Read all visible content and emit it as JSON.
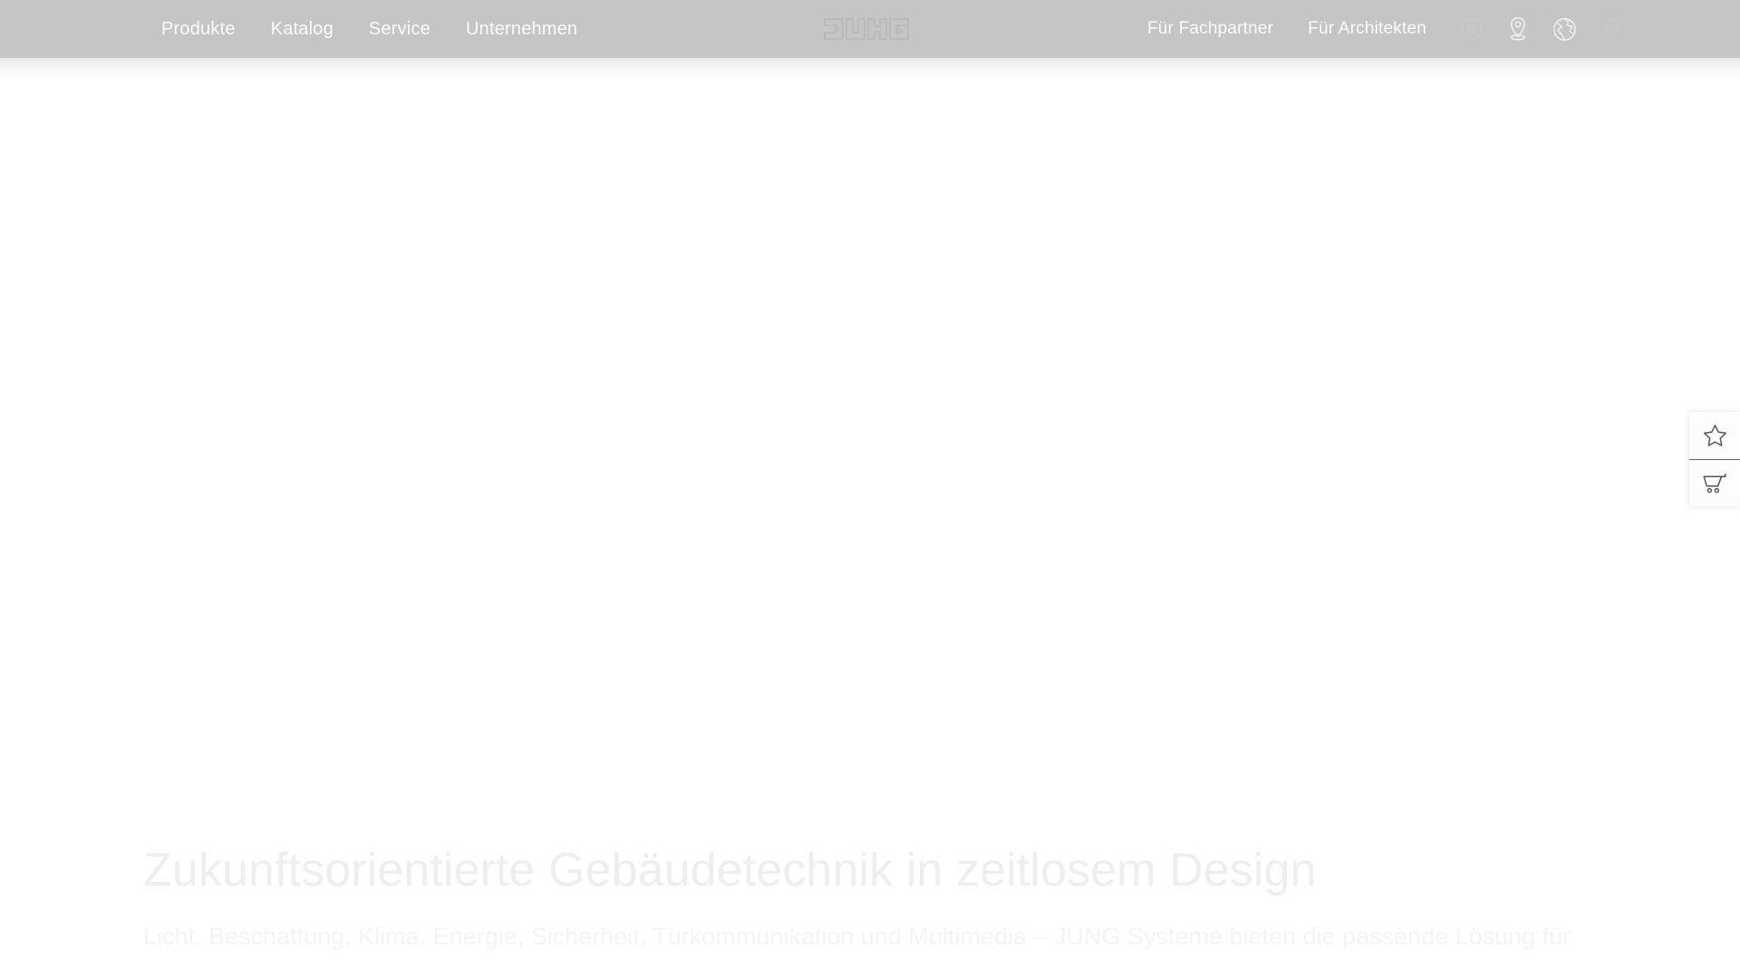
{
  "header": {
    "background_color": "#c5c5c5",
    "text_color": "#fbfbfb",
    "logo": {
      "name": "JUNG",
      "alt": "JUNG"
    },
    "nav_left": [
      {
        "label": "Produkte",
        "icon": ""
      },
      {
        "label": "Katalog",
        "icon": ""
      },
      {
        "label": "Service",
        "icon": ""
      },
      {
        "label": "Unternehmen",
        "icon": ""
      }
    ],
    "nav_right": [
      {
        "label": "Für Fachpartner"
      },
      {
        "label": "Für Architekten"
      }
    ],
    "icons": [
      {
        "name": "account-icon",
        "label": "Konto"
      },
      {
        "name": "location-pin-icon",
        "label": "Standort"
      },
      {
        "name": "globe-icon",
        "label": "Sprache"
      },
      {
        "name": "search-icon",
        "label": "Suche"
      }
    ]
  },
  "side_panel": {
    "background_color": "#fdfdfd",
    "items": [
      {
        "name": "favorites-icon",
        "label": "Merkliste"
      },
      {
        "name": "cart-icon",
        "label": "Warenkorb"
      }
    ]
  },
  "hero": {
    "title": "Zukunftsorientierte Gebäudetechnik in zeitlosem Design",
    "subtitle": "Licht, Beschattung, Klima, Energie, Sicherheit, Türkommunikation und Multimedia – JUNG Systeme bieten die passende Lösung für",
    "title_color": "#eeeeee",
    "subtitle_color": "#f4f4f4"
  },
  "page": {
    "background_color": "#ffffff"
  }
}
